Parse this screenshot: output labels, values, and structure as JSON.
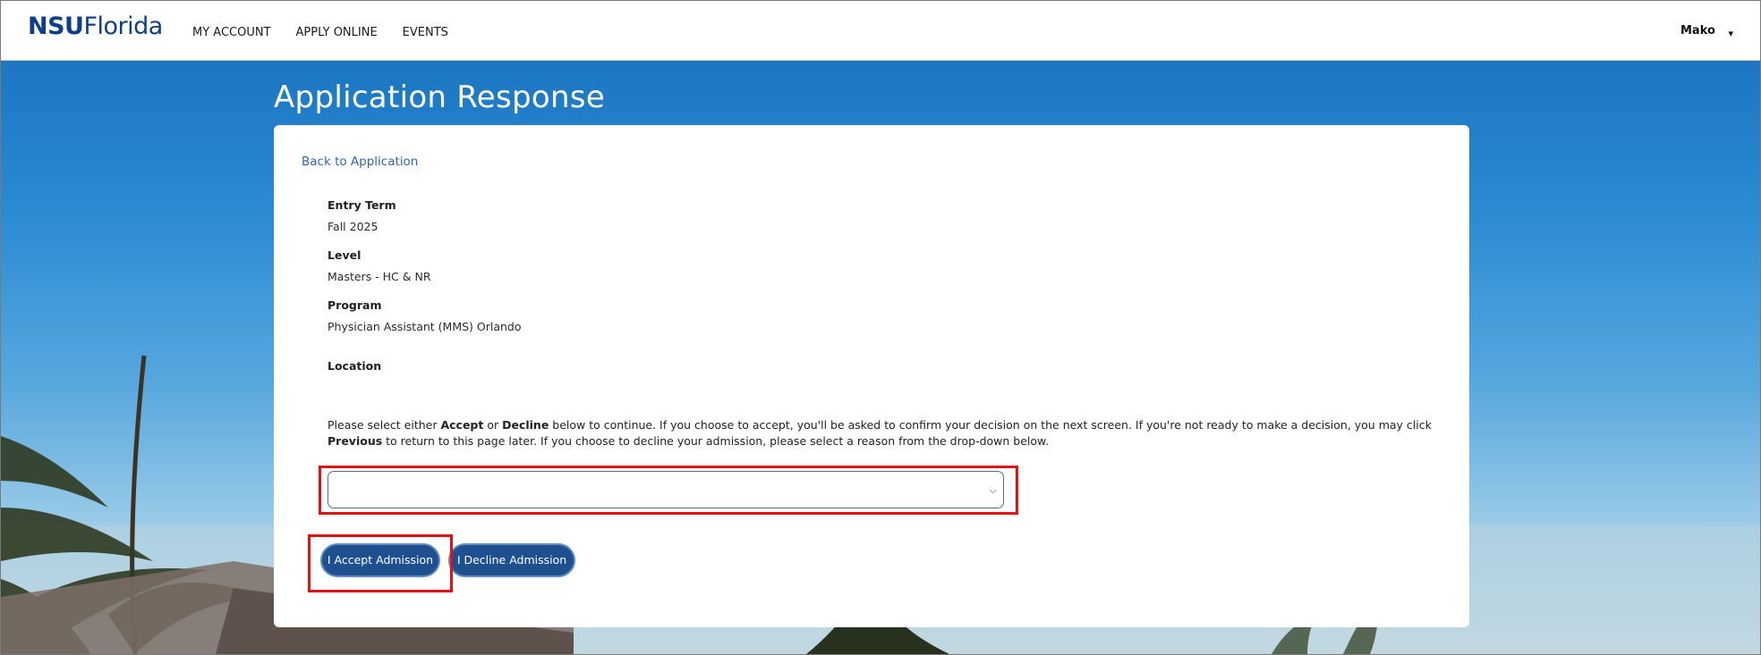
{
  "header": {
    "logo_bold": "NSU",
    "logo_light": "Florida",
    "nav": [
      "MY ACCOUNT",
      "APPLY ONLINE",
      "EVENTS"
    ],
    "user_name": "Mako",
    "user_caret": "▾"
  },
  "page": {
    "title": "Application Response"
  },
  "card": {
    "back_link": "Back to Application",
    "fields": {
      "entry_term_label": "Entry Term",
      "entry_term_value": "Fall 2025",
      "level_label": "Level",
      "level_value": "Masters - HC & NR",
      "program_label": "Program",
      "program_value": "Physician Assistant (MMS) Orlando",
      "location_label": "Location"
    },
    "instructions": {
      "p1": "Please select either ",
      "accept_word": "Accept",
      "p2": " or ",
      "decline_word": "Decline",
      "p3": " below to continue. If you choose to accept, you'll be asked to confirm your decision on the next screen. If you're not ready to make a decision, you may click ",
      "previous_word": "Previous",
      "p4": " to return to this page later. If you choose to decline your admission, please select a reason from the drop-down below."
    },
    "decline_reason_select": {
      "selected_value": ""
    },
    "accept_button": "I Accept Admission",
    "decline_button": "I Decline Admission"
  },
  "colors": {
    "brand_blue": "#0e3f8a",
    "button_blue": "#1e4f8f",
    "link_blue": "#2e67a8",
    "highlight_red": "#e01212"
  }
}
